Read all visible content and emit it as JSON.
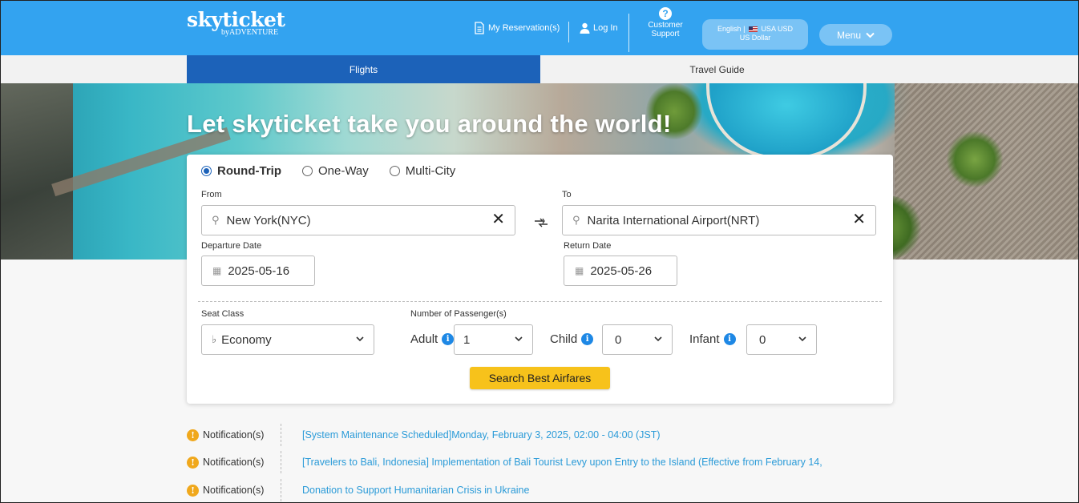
{
  "header": {
    "logo_main": "skyticket",
    "logo_sub": "byADVENTURE",
    "my_reservations": "My Reservation(s)",
    "log_in": "Log In",
    "support_line1": "Customer",
    "support_line2": "Support",
    "lang_line1_a": "English |",
    "lang_line1_b": "USA USD",
    "lang_line2": "US Dollar",
    "menu": "Menu"
  },
  "tabs": [
    {
      "label": "Flights",
      "active": true
    },
    {
      "label": "Travel Guide",
      "active": false
    }
  ],
  "hero": {
    "title": "Let skyticket take you around the world!"
  },
  "search": {
    "trip_types": [
      {
        "label": "Round-Trip",
        "checked": true
      },
      {
        "label": "One-Way",
        "checked": false
      },
      {
        "label": "Multi-City",
        "checked": false
      }
    ],
    "from_label": "From",
    "from_value": "New York(NYC)",
    "to_label": "To",
    "to_value": "Narita International Airport(NRT)",
    "departure_label": "Departure Date",
    "departure_value": "2025-05-16",
    "return_label": "Return Date",
    "return_value": "2025-05-26",
    "seat_class_label": "Seat Class",
    "seat_class_value": "Economy",
    "passengers_label": "Number of Passenger(s)",
    "adult_label": "Adult",
    "adult_value": "1",
    "child_label": "Child",
    "child_value": "0",
    "infant_label": "Infant",
    "infant_value": "0",
    "search_button": "Search Best Airfares"
  },
  "notifications": [
    {
      "tag": "Notification(s)",
      "text": "[System Maintenance Scheduled]Monday, February 3, 2025, 02:00 - 04:00 (JST)"
    },
    {
      "tag": "Notification(s)",
      "text": "[Travelers to Bali, Indonesia] Implementation of Bali Tourist Levy upon Entry to the Island (Effective from February 14,"
    },
    {
      "tag": "Notification(s)",
      "text": "Donation to Support Humanitarian Crisis in Ukraine"
    }
  ],
  "colors": {
    "header_bg": "#33a3f0",
    "tab_active": "#1c62b9",
    "search_button": "#f7c21b",
    "link": "#2b9bd8",
    "warning": "#f0a81c"
  }
}
